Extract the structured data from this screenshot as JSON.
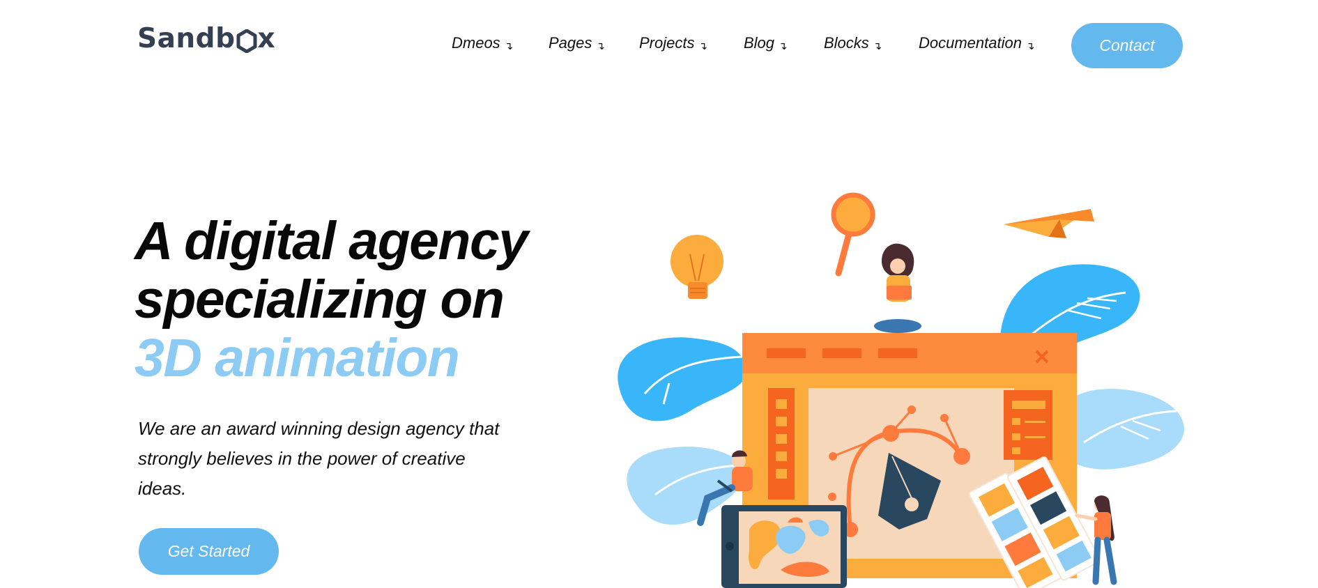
{
  "header": {
    "logo_text_start": "Sandb",
    "logo_text_end": "x",
    "nav": [
      {
        "label": "Dmeos",
        "caret": "↴"
      },
      {
        "label": "Pages",
        "caret": "↴"
      },
      {
        "label": "Projects",
        "caret": "↴"
      },
      {
        "label": "Blog",
        "caret": "↴"
      },
      {
        "label": "Blocks",
        "caret": "↴"
      },
      {
        "label": "Documentation",
        "caret": "↴"
      }
    ],
    "contact_label": "Contact"
  },
  "hero": {
    "headline_line1": "A digital agency",
    "headline_line2": "specializing on",
    "headline_accent": "3D animation",
    "lead": "We are an award winning design agency that strongly believes in the power of creative ideas.",
    "cta_label": "Get Started"
  },
  "colors": {
    "accent_button": "#63b8ee",
    "accent_text": "#8ccbf3",
    "logo": "#343f52",
    "illustration_orange": "#fe7a3d",
    "illustration_yellow": "#fcac3c",
    "illustration_blue": "#38b6f9"
  }
}
